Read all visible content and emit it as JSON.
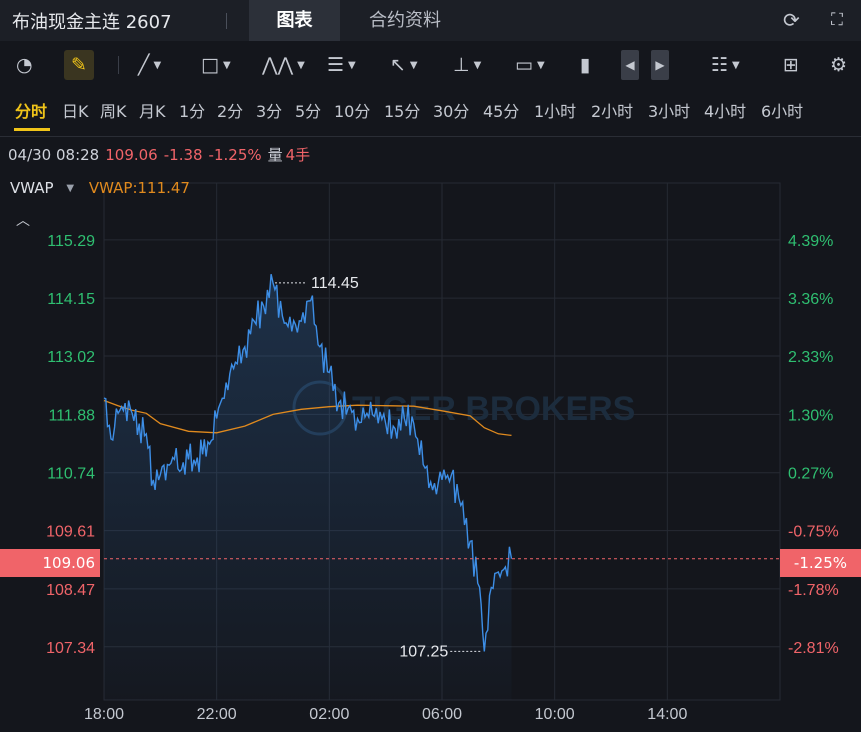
{
  "header": {
    "title": "布油现金主连 2607",
    "tabs": [
      "图表",
      "合约资料"
    ],
    "active_tab": "图表",
    "icons": [
      "refresh-icon",
      "expand-icon"
    ]
  },
  "toolbar": {
    "tools": [
      "gauge-icon",
      "pencil-icon",
      "line-draw-icon",
      "rectangle-icon",
      "pattern-icon",
      "fib-icon",
      "arrow-icon",
      "vertical-line-icon",
      "text-icon",
      "candle-icon",
      "prev-icon",
      "next-icon",
      "layout-list-icon",
      "grid-icon",
      "settings-icon"
    ],
    "active_color": "#f0c419"
  },
  "periods": [
    "分时",
    "日K",
    "周K",
    "月K",
    "1分",
    "2分",
    "3分",
    "5分",
    "10分",
    "15分",
    "30分",
    "45分",
    "1小时",
    "2小时",
    "3小时",
    "4小时",
    "6小时"
  ],
  "selected_period": "分时",
  "quote": {
    "datetime": "04/30 08:28",
    "price": "109.06",
    "change": "-1.38",
    "change_pct": "-1.25%",
    "volume_label": "量",
    "volume": "4手"
  },
  "indicator": {
    "name": "VWAP",
    "value_label": "VWAP:111.47"
  },
  "colors": {
    "background": "#14161c",
    "up": "#2fbf71",
    "down": "#f06469",
    "price_line": "#3d8ee6",
    "vwap_line": "#e08a1e",
    "grid": "#262a33"
  },
  "watermark": "TIGER BROKERS",
  "chart_data": {
    "type": "line",
    "x_ticks": [
      "18:00",
      "22:00",
      "02:00",
      "06:00",
      "10:00",
      "14:00"
    ],
    "y_ticks": [
      "115.29",
      "114.15",
      "113.02",
      "111.88",
      "110.74",
      "109.61",
      "108.47",
      "107.34"
    ],
    "y_ticks_pct": [
      "4.39%",
      "3.36%",
      "2.33%",
      "1.30%",
      "0.27%",
      "-0.75%",
      "-1.78%",
      "-2.81%"
    ],
    "current_price": "109.06",
    "current_pct": "-1.25%",
    "high_label": "114.45",
    "low_label": "107.25",
    "high": 114.45,
    "low": 107.25,
    "ylim": [
      106.3,
      116.4
    ],
    "series": [
      {
        "name": "price",
        "x": [
          "18:00",
          "18:15",
          "18:30",
          "18:45",
          "19:00",
          "19:15",
          "19:30",
          "19:45",
          "20:00",
          "20:15",
          "20:30",
          "20:45",
          "21:00",
          "21:15",
          "21:30",
          "21:45",
          "22:00",
          "22:20",
          "22:40",
          "23:00",
          "23:20",
          "23:40",
          "00:00",
          "00:20",
          "00:40",
          "01:00",
          "01:20",
          "01:40",
          "02:00",
          "02:20",
          "02:40",
          "03:00",
          "03:20",
          "03:40",
          "04:00",
          "04:20",
          "04:40",
          "05:00",
          "05:20",
          "05:40",
          "06:00",
          "06:20",
          "06:40",
          "07:00",
          "07:20",
          "07:30",
          "07:45",
          "08:00",
          "08:15",
          "08:28"
        ],
        "y": [
          112.2,
          111.4,
          111.9,
          112.1,
          111.9,
          111.7,
          111.5,
          110.6,
          110.7,
          110.9,
          111.0,
          110.8,
          111.0,
          110.9,
          111.1,
          111.3,
          111.8,
          112.5,
          112.9,
          113.2,
          113.7,
          114.0,
          114.45,
          113.8,
          113.5,
          113.7,
          114.1,
          113.2,
          112.7,
          112.1,
          112.0,
          111.8,
          111.9,
          112.0,
          111.7,
          111.6,
          111.8,
          111.7,
          110.9,
          110.4,
          110.6,
          110.7,
          110.1,
          109.4,
          108.5,
          107.25,
          108.5,
          108.8,
          108.9,
          109.06
        ]
      },
      {
        "name": "VWAP",
        "x": [
          "18:00",
          "18:30",
          "19:00",
          "19:30",
          "20:00",
          "21:00",
          "22:00",
          "23:00",
          "00:00",
          "01:00",
          "02:00",
          "03:00",
          "04:00",
          "05:00",
          "06:00",
          "07:00",
          "07:30",
          "08:00",
          "08:28"
        ],
        "y": [
          112.15,
          112.05,
          111.96,
          111.9,
          111.7,
          111.55,
          111.52,
          111.65,
          111.88,
          111.98,
          112.03,
          112.06,
          112.05,
          112.04,
          111.95,
          111.85,
          111.62,
          111.5,
          111.47
        ]
      }
    ]
  }
}
